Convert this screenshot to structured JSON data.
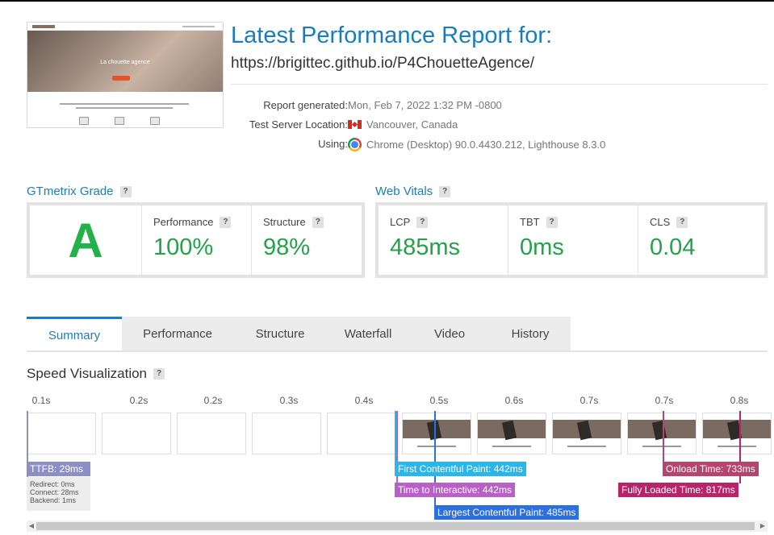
{
  "report": {
    "title": "Latest Performance Report for:",
    "url": "https://brigittec.github.io/P4ChouetteAgence/"
  },
  "thumbnail": {
    "hero_title": "La chouette agence"
  },
  "meta": [
    {
      "label": "Report generated:",
      "value": "Mon, Feb 7, 2022 1:32 PM -0800",
      "icon": ""
    },
    {
      "label": "Test Server Location:",
      "value": "Vancouver, Canada",
      "icon": "flag-canada-icon"
    },
    {
      "label": "Using:",
      "value": "Chrome (Desktop) 90.0.4430.212, Lighthouse 8.3.0",
      "icon": "chrome-icon"
    }
  ],
  "grade": {
    "title": "GTmetrix Grade",
    "letter": "A",
    "help": "?",
    "performance": {
      "label": "Performance",
      "value": "100%"
    },
    "structure": {
      "label": "Structure",
      "value": "98%"
    }
  },
  "vitals": {
    "title": "Web Vitals",
    "help": "?",
    "items": [
      {
        "label": "LCP",
        "value": "485ms"
      },
      {
        "label": "TBT",
        "value": "0ms"
      },
      {
        "label": "CLS",
        "value": "0.04"
      }
    ]
  },
  "tabs": [
    {
      "label": "Summary",
      "active": true
    },
    {
      "label": "Performance",
      "active": false
    },
    {
      "label": "Structure",
      "active": false
    },
    {
      "label": "Waterfall",
      "active": false
    },
    {
      "label": "Video",
      "active": false
    },
    {
      "label": "History",
      "active": false
    }
  ],
  "speed": {
    "title": "Speed Visualization",
    "help": "?",
    "ticks": [
      "0.1s",
      "0.2s",
      "0.2s",
      "0.3s",
      "0.4s",
      "0.5s",
      "0.6s",
      "0.7s",
      "0.7s",
      "0.8s"
    ],
    "markers": {
      "ttfb": "TTFB: 29ms",
      "fcp": "First Contentful Paint: 442ms",
      "tti": "Time to Interactive: 442ms",
      "lcp": "Largest Contentful Paint: 485ms",
      "onload": "Onload Time: 733ms",
      "fully_loaded": "Fully Loaded Time: 817ms"
    },
    "ttfb_details": [
      "Redirect: 0ms",
      "Connect: 28ms",
      "Backend: 1ms"
    ]
  },
  "colors": {
    "accent": "#1a7cc0",
    "grade_green": "#23b14a",
    "ttfb": "#8c8fc4",
    "fcp": "#29b6ec",
    "tti": "#b85fc8",
    "lcp": "#2c6fe0",
    "onload": "#b5446e",
    "fully_loaded": "#b8246a"
  }
}
